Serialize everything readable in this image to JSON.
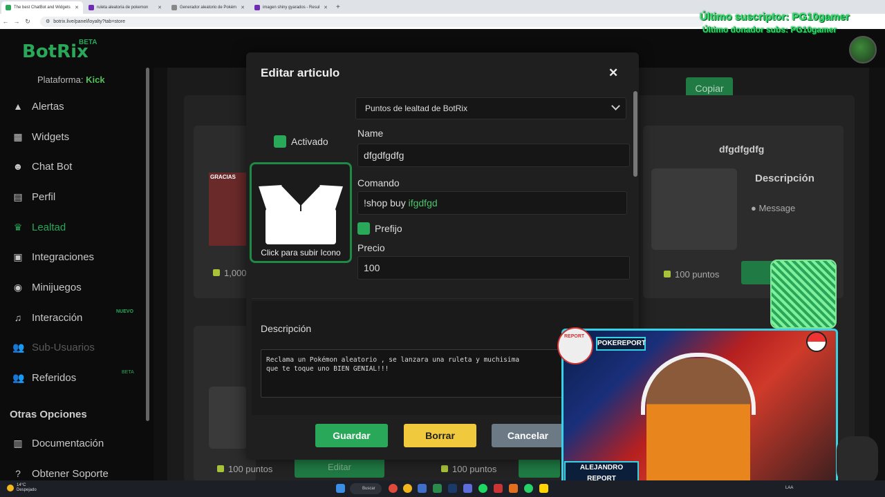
{
  "browser": {
    "tabs": [
      {
        "title": "The best ChatBot and Widgets",
        "active": true,
        "color": "#2aa85a"
      },
      {
        "title": "ruleta aleatoria de pokemon",
        "active": false,
        "color": "#6f2bb5"
      },
      {
        "title": "Generador aleatorio de Pokém",
        "active": false,
        "color": "#888888"
      },
      {
        "title": "imagen shiny gyarados - Resul",
        "active": false,
        "color": "#6f2bb5"
      }
    ],
    "url": "botrix.live/panel/loyalty?tab=store"
  },
  "app": {
    "logo": "BotRix",
    "beta": "BETA",
    "platform_label": "Plataforma:",
    "platform_value": "Kick",
    "accent": "#2aa85a"
  },
  "sidebar": {
    "items": [
      {
        "label": "Alertas",
        "icon": "bell-icon"
      },
      {
        "label": "Widgets",
        "icon": "grid-icon"
      },
      {
        "label": "Chat Bot",
        "icon": "robot-icon"
      },
      {
        "label": "Perfil",
        "icon": "id-card-icon"
      },
      {
        "label": "Lealtad",
        "icon": "trophy-icon"
      },
      {
        "label": "Integraciones",
        "icon": "integration-icon"
      },
      {
        "label": "Minijuegos",
        "icon": "gamepad-icon"
      },
      {
        "label": "Interacción",
        "icon": "music-icon"
      },
      {
        "label": "Sub-Usuarios",
        "icon": "users-icon"
      },
      {
        "label": "Referidos",
        "icon": "referral-icon"
      }
    ],
    "badge_nuevo": "NUEVO",
    "badge_beta": "BETA",
    "other_section": "Otras Opciones",
    "other_items": [
      {
        "label": "Documentación",
        "icon": "book-icon"
      },
      {
        "label": "Obtener Soporte",
        "icon": "help-icon"
      }
    ]
  },
  "background": {
    "copy_button": "Copiar",
    "card_right_title": "dfgdfgdfg",
    "card_right_desc": "Descripción",
    "card_right_message": "Message",
    "points_a": "1,000",
    "points_b": "100 puntos",
    "points_c": "100 puntos",
    "points_d": "100 puntos",
    "edit_label": "Editar",
    "thumb_text": "GRACIAS"
  },
  "modal": {
    "title": "Editar articulo",
    "currency_select": "Puntos de lealtad de BotRix",
    "enabled_label": "Activado",
    "upload_label": "Click para subir Icono",
    "name_label": "Name",
    "name_value": "dfgdfgdfg",
    "command_label": "Comando",
    "command_value": "!shop buy",
    "command_arg": "ifgdfgd",
    "prefix_label": "Prefijo",
    "price_label": "Precio",
    "price_value": "100",
    "description_label": "Descripción",
    "description_line1": "Reclama un Pokémon aleatorio , se lanzara una ruleta y muchisima",
    "description_line2": "que te toque uno BIEN GENIAL!!!",
    "save": "Guardar",
    "delete": "Borrar",
    "cancel": "Cancelar"
  },
  "overlay": {
    "last_subscriber": "Último suscriptor: PG10gamer",
    "last_donor": "Último donador subs: PG10gamer",
    "cam_top_tag": "POKEREPORT",
    "cam_bottom_tag": "ALEJANDRO REPORT",
    "report_tag": "REPORT"
  },
  "taskbar": {
    "weather_temp": "14°C",
    "weather_desc": "Despejado",
    "search": "Buscar",
    "lang": "LAA"
  }
}
